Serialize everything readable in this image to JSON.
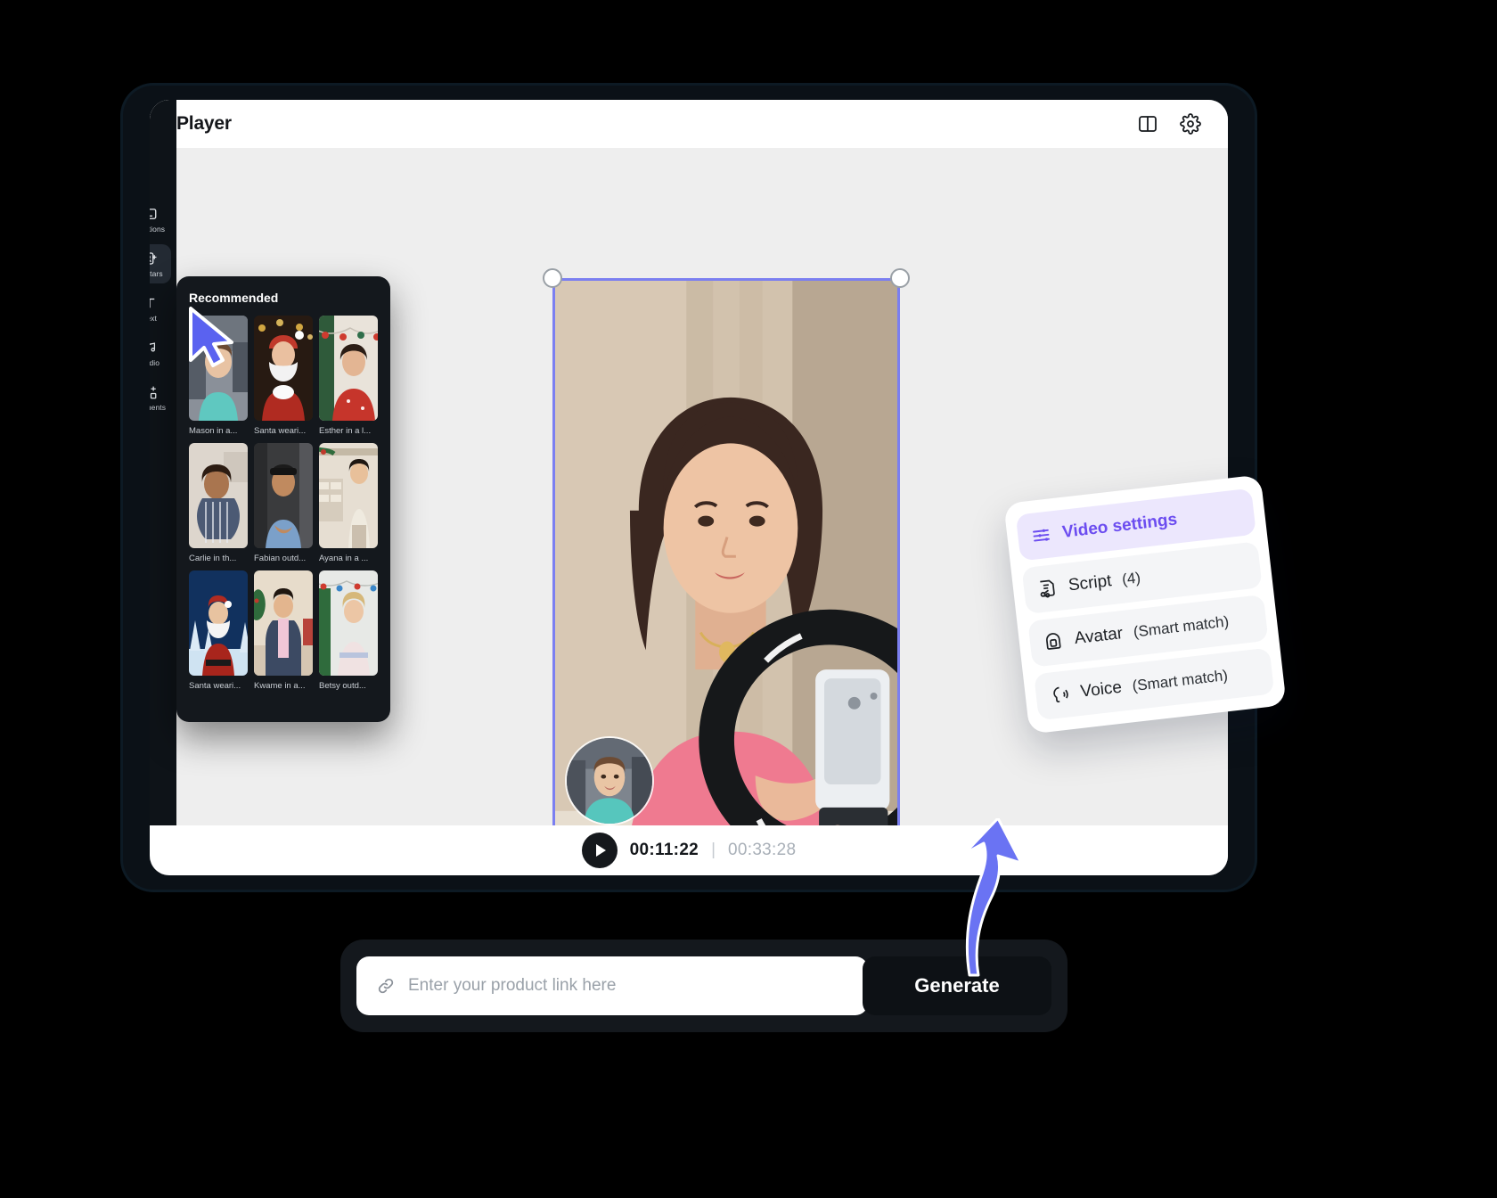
{
  "app": {
    "header": {
      "title": "Player",
      "icons": [
        {
          "name": "layout-panel-icon"
        },
        {
          "name": "gear-icon"
        }
      ]
    }
  },
  "sidebar": {
    "items": [
      {
        "label": "Captions",
        "icon": "captions-icon",
        "active": false
      },
      {
        "label": "Avatars",
        "icon": "avatar-card-icon",
        "active": true
      },
      {
        "label": "Text",
        "icon": "text-t-icon",
        "active": false
      },
      {
        "label": "Audio",
        "icon": "music-note-icon",
        "active": false
      },
      {
        "label": "Elements",
        "icon": "elements-icon",
        "active": false
      }
    ]
  },
  "recommended": {
    "title": "Recommended",
    "items": [
      {
        "caption": "Mason in a..."
      },
      {
        "caption": "Santa weari..."
      },
      {
        "caption": "Esther in a l..."
      },
      {
        "caption": "Carlie in th..."
      },
      {
        "caption": "Fabian outd..."
      },
      {
        "caption": "Ayana in a ..."
      },
      {
        "caption": "Santa weari..."
      },
      {
        "caption": "Kwame in a..."
      },
      {
        "caption": "Betsy outd..."
      }
    ]
  },
  "player": {
    "current_time": "00:11:22",
    "separator": "|",
    "total_time": "00:33:28",
    "play_icon": "play-icon"
  },
  "settings_card": {
    "rows": [
      {
        "label": "Video settings",
        "suffix": "",
        "icon": "sliders-icon",
        "selected": true
      },
      {
        "label": "Script",
        "suffix": " (4)",
        "icon": "script-icon",
        "selected": false
      },
      {
        "label": "Avatar",
        "suffix": " (Smart match)",
        "icon": "avatar-frame-icon",
        "selected": false
      },
      {
        "label": "Voice",
        "suffix": " (Smart match)",
        "icon": "voice-icon",
        "selected": false
      }
    ]
  },
  "prompt_bar": {
    "placeholder": "Enter your product link here",
    "value": "",
    "icon": "link-icon",
    "generate_label": "Generate"
  },
  "colors": {
    "accent_purple": "#6c4df0",
    "accent_purple_soft": "#ece7fd",
    "selection_border": "#7b7ff0",
    "dark_panel": "#14181d",
    "canvas_bg": "#eeeeee",
    "arrow_blue": "#5a62f0"
  }
}
